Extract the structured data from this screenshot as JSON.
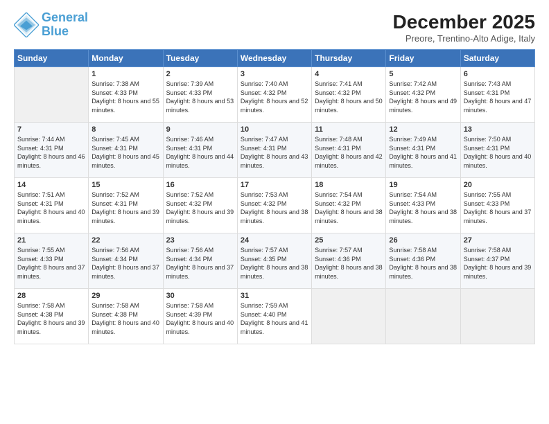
{
  "logo": {
    "line1": "General",
    "line2": "Blue"
  },
  "title": "December 2025",
  "subtitle": "Preore, Trentino-Alto Adige, Italy",
  "weekdays": [
    "Sunday",
    "Monday",
    "Tuesday",
    "Wednesday",
    "Thursday",
    "Friday",
    "Saturday"
  ],
  "weeks": [
    [
      {
        "day": "",
        "empty": true
      },
      {
        "day": "1",
        "sunrise": "7:38 AM",
        "sunset": "4:33 PM",
        "daylight": "8 hours and 55 minutes."
      },
      {
        "day": "2",
        "sunrise": "7:39 AM",
        "sunset": "4:33 PM",
        "daylight": "8 hours and 53 minutes."
      },
      {
        "day": "3",
        "sunrise": "7:40 AM",
        "sunset": "4:32 PM",
        "daylight": "8 hours and 52 minutes."
      },
      {
        "day": "4",
        "sunrise": "7:41 AM",
        "sunset": "4:32 PM",
        "daylight": "8 hours and 50 minutes."
      },
      {
        "day": "5",
        "sunrise": "7:42 AM",
        "sunset": "4:32 PM",
        "daylight": "8 hours and 49 minutes."
      },
      {
        "day": "6",
        "sunrise": "7:43 AM",
        "sunset": "4:31 PM",
        "daylight": "8 hours and 47 minutes."
      }
    ],
    [
      {
        "day": "7",
        "sunrise": "7:44 AM",
        "sunset": "4:31 PM",
        "daylight": "8 hours and 46 minutes."
      },
      {
        "day": "8",
        "sunrise": "7:45 AM",
        "sunset": "4:31 PM",
        "daylight": "8 hours and 45 minutes."
      },
      {
        "day": "9",
        "sunrise": "7:46 AM",
        "sunset": "4:31 PM",
        "daylight": "8 hours and 44 minutes."
      },
      {
        "day": "10",
        "sunrise": "7:47 AM",
        "sunset": "4:31 PM",
        "daylight": "8 hours and 43 minutes."
      },
      {
        "day": "11",
        "sunrise": "7:48 AM",
        "sunset": "4:31 PM",
        "daylight": "8 hours and 42 minutes."
      },
      {
        "day": "12",
        "sunrise": "7:49 AM",
        "sunset": "4:31 PM",
        "daylight": "8 hours and 41 minutes."
      },
      {
        "day": "13",
        "sunrise": "7:50 AM",
        "sunset": "4:31 PM",
        "daylight": "8 hours and 40 minutes."
      }
    ],
    [
      {
        "day": "14",
        "sunrise": "7:51 AM",
        "sunset": "4:31 PM",
        "daylight": "8 hours and 40 minutes."
      },
      {
        "day": "15",
        "sunrise": "7:52 AM",
        "sunset": "4:31 PM",
        "daylight": "8 hours and 39 minutes."
      },
      {
        "day": "16",
        "sunrise": "7:52 AM",
        "sunset": "4:32 PM",
        "daylight": "8 hours and 39 minutes."
      },
      {
        "day": "17",
        "sunrise": "7:53 AM",
        "sunset": "4:32 PM",
        "daylight": "8 hours and 38 minutes."
      },
      {
        "day": "18",
        "sunrise": "7:54 AM",
        "sunset": "4:32 PM",
        "daylight": "8 hours and 38 minutes."
      },
      {
        "day": "19",
        "sunrise": "7:54 AM",
        "sunset": "4:33 PM",
        "daylight": "8 hours and 38 minutes."
      },
      {
        "day": "20",
        "sunrise": "7:55 AM",
        "sunset": "4:33 PM",
        "daylight": "8 hours and 37 minutes."
      }
    ],
    [
      {
        "day": "21",
        "sunrise": "7:55 AM",
        "sunset": "4:33 PM",
        "daylight": "8 hours and 37 minutes."
      },
      {
        "day": "22",
        "sunrise": "7:56 AM",
        "sunset": "4:34 PM",
        "daylight": "8 hours and 37 minutes."
      },
      {
        "day": "23",
        "sunrise": "7:56 AM",
        "sunset": "4:34 PM",
        "daylight": "8 hours and 37 minutes."
      },
      {
        "day": "24",
        "sunrise": "7:57 AM",
        "sunset": "4:35 PM",
        "daylight": "8 hours and 38 minutes."
      },
      {
        "day": "25",
        "sunrise": "7:57 AM",
        "sunset": "4:36 PM",
        "daylight": "8 hours and 38 minutes."
      },
      {
        "day": "26",
        "sunrise": "7:58 AM",
        "sunset": "4:36 PM",
        "daylight": "8 hours and 38 minutes."
      },
      {
        "day": "27",
        "sunrise": "7:58 AM",
        "sunset": "4:37 PM",
        "daylight": "8 hours and 39 minutes."
      }
    ],
    [
      {
        "day": "28",
        "sunrise": "7:58 AM",
        "sunset": "4:38 PM",
        "daylight": "8 hours and 39 minutes."
      },
      {
        "day": "29",
        "sunrise": "7:58 AM",
        "sunset": "4:38 PM",
        "daylight": "8 hours and 40 minutes."
      },
      {
        "day": "30",
        "sunrise": "7:58 AM",
        "sunset": "4:39 PM",
        "daylight": "8 hours and 40 minutes."
      },
      {
        "day": "31",
        "sunrise": "7:59 AM",
        "sunset": "4:40 PM",
        "daylight": "8 hours and 41 minutes."
      },
      {
        "day": "",
        "empty": true
      },
      {
        "day": "",
        "empty": true
      },
      {
        "day": "",
        "empty": true
      }
    ]
  ],
  "labels": {
    "sunrise": "Sunrise:",
    "sunset": "Sunset:",
    "daylight": "Daylight:"
  }
}
